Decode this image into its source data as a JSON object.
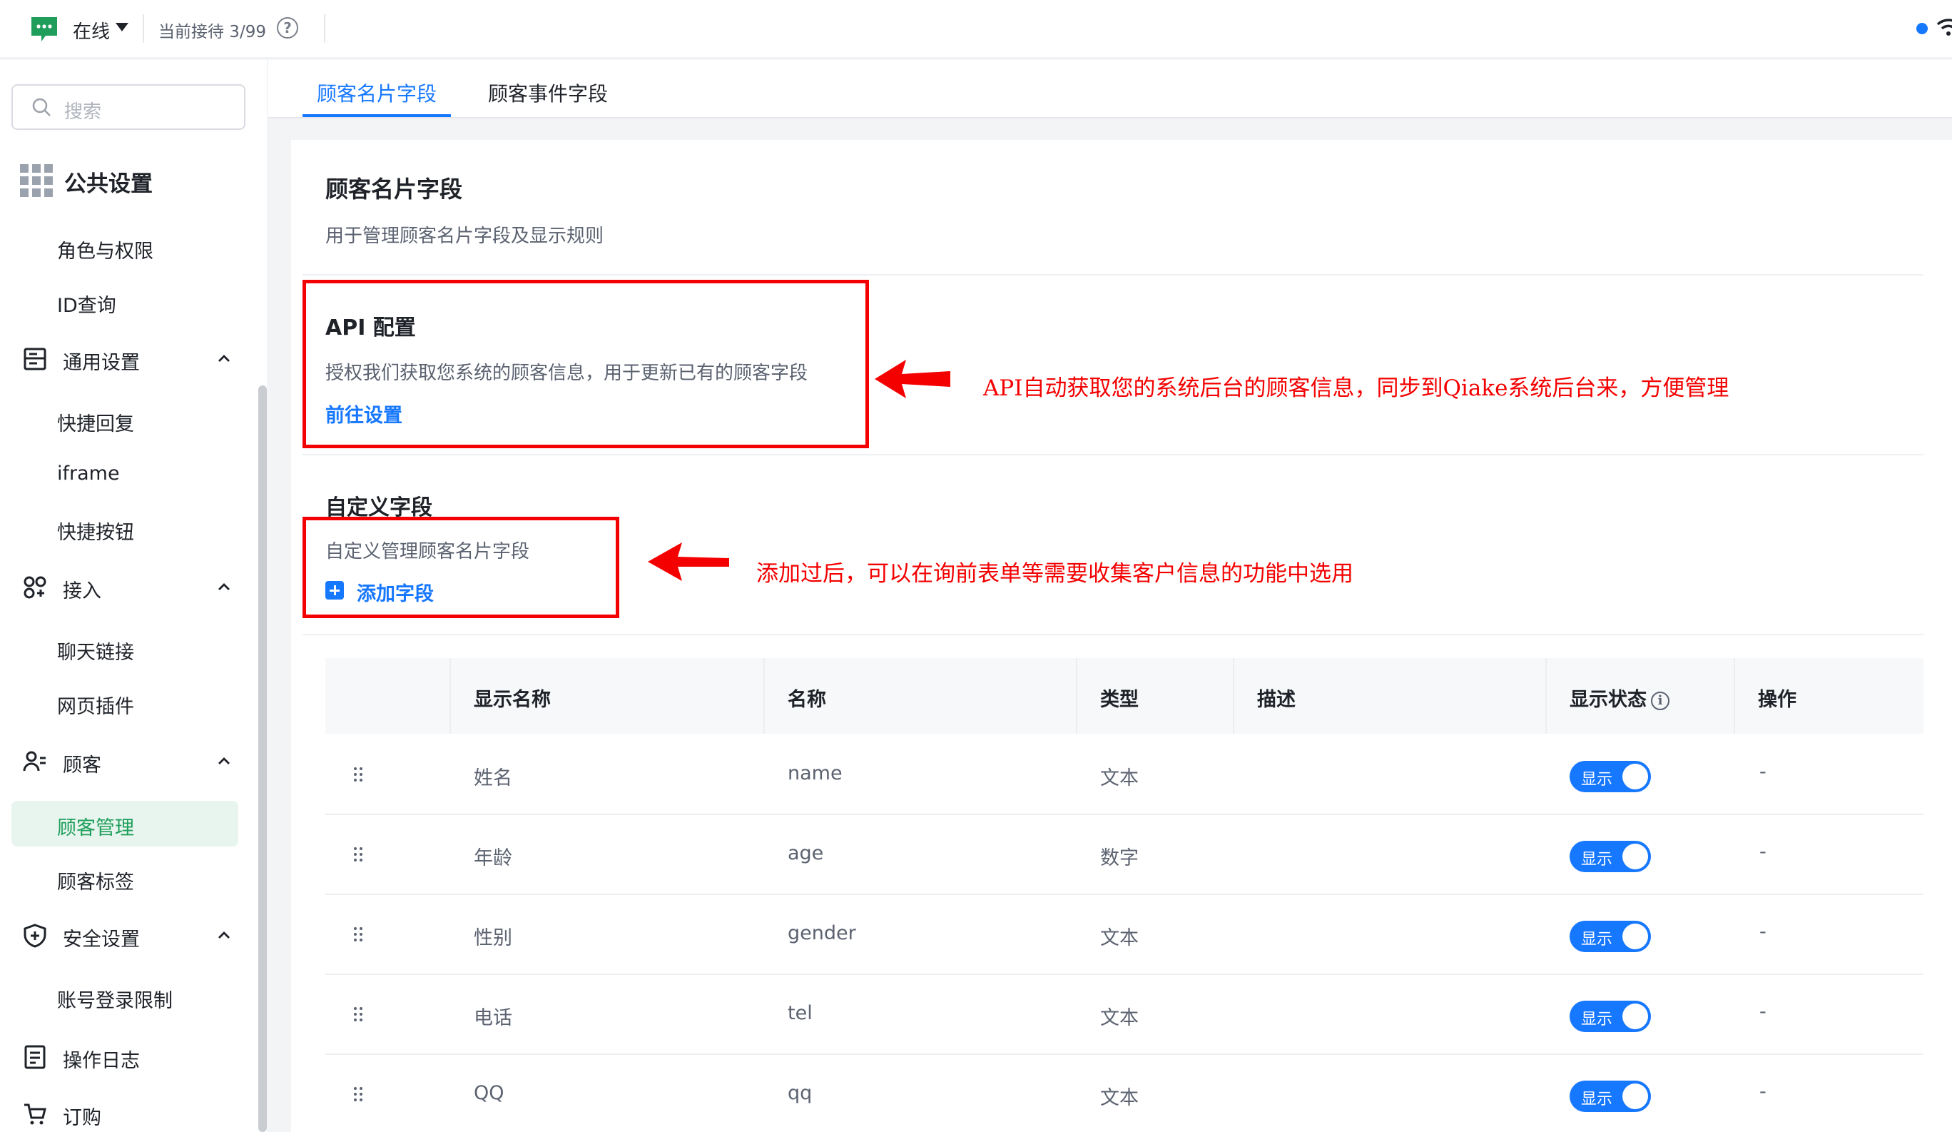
{
  "topbar": {
    "status": "在线",
    "reception": "当前接待 3/99",
    "help_icon": "question-circle-icon",
    "colors": {
      "brand": "#1e9e5a",
      "accent": "#1677ff"
    }
  },
  "sidebar": {
    "search_placeholder": "搜索",
    "section_title": "公共设置",
    "items": {
      "roles": "角色与权限",
      "id_query": "ID查询",
      "general": "通用设置",
      "quick_reply": "快捷回复",
      "iframe": "iframe",
      "quick_button": "快捷按钮",
      "access": "接入",
      "chat_link": "聊天链接",
      "web_plugin": "网页插件",
      "customer": "顾客",
      "customer_mgmt": "顾客管理",
      "customer_tags": "顾客标签",
      "security": "安全设置",
      "login_limit": "账号登录限制",
      "op_log": "操作日志",
      "order": "订购"
    }
  },
  "tabs": [
    "顾客名片字段",
    "顾客事件字段"
  ],
  "page": {
    "title": "顾客名片字段",
    "desc": "用于管理顾客名片字段及显示规则"
  },
  "api": {
    "title": "API 配置",
    "desc": "授权我们获取您系统的顾客信息，用于更新已有的顾客字段",
    "link": "前往设置"
  },
  "custom": {
    "title": "自定义字段",
    "desc": "自定义管理顾客名片字段",
    "add": "添加字段"
  },
  "annotations": {
    "api": "API自动获取您的系统后台的顾客信息，同步到Qiake系统后台来，方便管理",
    "custom": "添加过后，可以在询前表单等需要收集客户信息的功能中选用"
  },
  "table": {
    "headers": [
      "显示名称",
      "名称",
      "类型",
      "描述",
      "显示状态",
      "操作"
    ],
    "rows": [
      {
        "display": "姓名",
        "name": "name",
        "type": "文本",
        "desc": "",
        "status": "显示",
        "op": "-"
      },
      {
        "display": "年龄",
        "name": "age",
        "type": "数字",
        "desc": "",
        "status": "显示",
        "op": "-"
      },
      {
        "display": "性别",
        "name": "gender",
        "type": "文本",
        "desc": "",
        "status": "显示",
        "op": "-"
      },
      {
        "display": "电话",
        "name": "tel",
        "type": "文本",
        "desc": "",
        "status": "显示",
        "op": "-"
      },
      {
        "display": "QQ",
        "name": "qq",
        "type": "文本",
        "desc": "",
        "status": "显示",
        "op": "-"
      }
    ]
  }
}
